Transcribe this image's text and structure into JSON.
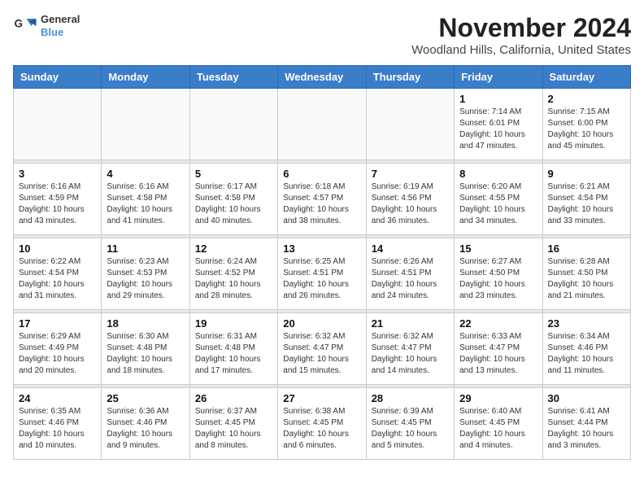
{
  "logo": {
    "line1": "General",
    "line2": "Blue"
  },
  "title": "November 2024",
  "subtitle": "Woodland Hills, California, United States",
  "days_of_week": [
    "Sunday",
    "Monday",
    "Tuesday",
    "Wednesday",
    "Thursday",
    "Friday",
    "Saturday"
  ],
  "weeks": [
    [
      {
        "day": "",
        "info": ""
      },
      {
        "day": "",
        "info": ""
      },
      {
        "day": "",
        "info": ""
      },
      {
        "day": "",
        "info": ""
      },
      {
        "day": "",
        "info": ""
      },
      {
        "day": "1",
        "info": "Sunrise: 7:14 AM\nSunset: 6:01 PM\nDaylight: 10 hours and 47 minutes."
      },
      {
        "day": "2",
        "info": "Sunrise: 7:15 AM\nSunset: 6:00 PM\nDaylight: 10 hours and 45 minutes."
      }
    ],
    [
      {
        "day": "3",
        "info": "Sunrise: 6:16 AM\nSunset: 4:59 PM\nDaylight: 10 hours and 43 minutes."
      },
      {
        "day": "4",
        "info": "Sunrise: 6:16 AM\nSunset: 4:58 PM\nDaylight: 10 hours and 41 minutes."
      },
      {
        "day": "5",
        "info": "Sunrise: 6:17 AM\nSunset: 4:58 PM\nDaylight: 10 hours and 40 minutes."
      },
      {
        "day": "6",
        "info": "Sunrise: 6:18 AM\nSunset: 4:57 PM\nDaylight: 10 hours and 38 minutes."
      },
      {
        "day": "7",
        "info": "Sunrise: 6:19 AM\nSunset: 4:56 PM\nDaylight: 10 hours and 36 minutes."
      },
      {
        "day": "8",
        "info": "Sunrise: 6:20 AM\nSunset: 4:55 PM\nDaylight: 10 hours and 34 minutes."
      },
      {
        "day": "9",
        "info": "Sunrise: 6:21 AM\nSunset: 4:54 PM\nDaylight: 10 hours and 33 minutes."
      }
    ],
    [
      {
        "day": "10",
        "info": "Sunrise: 6:22 AM\nSunset: 4:54 PM\nDaylight: 10 hours and 31 minutes."
      },
      {
        "day": "11",
        "info": "Sunrise: 6:23 AM\nSunset: 4:53 PM\nDaylight: 10 hours and 29 minutes."
      },
      {
        "day": "12",
        "info": "Sunrise: 6:24 AM\nSunset: 4:52 PM\nDaylight: 10 hours and 28 minutes."
      },
      {
        "day": "13",
        "info": "Sunrise: 6:25 AM\nSunset: 4:51 PM\nDaylight: 10 hours and 26 minutes."
      },
      {
        "day": "14",
        "info": "Sunrise: 6:26 AM\nSunset: 4:51 PM\nDaylight: 10 hours and 24 minutes."
      },
      {
        "day": "15",
        "info": "Sunrise: 6:27 AM\nSunset: 4:50 PM\nDaylight: 10 hours and 23 minutes."
      },
      {
        "day": "16",
        "info": "Sunrise: 6:28 AM\nSunset: 4:50 PM\nDaylight: 10 hours and 21 minutes."
      }
    ],
    [
      {
        "day": "17",
        "info": "Sunrise: 6:29 AM\nSunset: 4:49 PM\nDaylight: 10 hours and 20 minutes."
      },
      {
        "day": "18",
        "info": "Sunrise: 6:30 AM\nSunset: 4:48 PM\nDaylight: 10 hours and 18 minutes."
      },
      {
        "day": "19",
        "info": "Sunrise: 6:31 AM\nSunset: 4:48 PM\nDaylight: 10 hours and 17 minutes."
      },
      {
        "day": "20",
        "info": "Sunrise: 6:32 AM\nSunset: 4:47 PM\nDaylight: 10 hours and 15 minutes."
      },
      {
        "day": "21",
        "info": "Sunrise: 6:32 AM\nSunset: 4:47 PM\nDaylight: 10 hours and 14 minutes."
      },
      {
        "day": "22",
        "info": "Sunrise: 6:33 AM\nSunset: 4:47 PM\nDaylight: 10 hours and 13 minutes."
      },
      {
        "day": "23",
        "info": "Sunrise: 6:34 AM\nSunset: 4:46 PM\nDaylight: 10 hours and 11 minutes."
      }
    ],
    [
      {
        "day": "24",
        "info": "Sunrise: 6:35 AM\nSunset: 4:46 PM\nDaylight: 10 hours and 10 minutes."
      },
      {
        "day": "25",
        "info": "Sunrise: 6:36 AM\nSunset: 4:46 PM\nDaylight: 10 hours and 9 minutes."
      },
      {
        "day": "26",
        "info": "Sunrise: 6:37 AM\nSunset: 4:45 PM\nDaylight: 10 hours and 8 minutes."
      },
      {
        "day": "27",
        "info": "Sunrise: 6:38 AM\nSunset: 4:45 PM\nDaylight: 10 hours and 6 minutes."
      },
      {
        "day": "28",
        "info": "Sunrise: 6:39 AM\nSunset: 4:45 PM\nDaylight: 10 hours and 5 minutes."
      },
      {
        "day": "29",
        "info": "Sunrise: 6:40 AM\nSunset: 4:45 PM\nDaylight: 10 hours and 4 minutes."
      },
      {
        "day": "30",
        "info": "Sunrise: 6:41 AM\nSunset: 4:44 PM\nDaylight: 10 hours and 3 minutes."
      }
    ]
  ]
}
